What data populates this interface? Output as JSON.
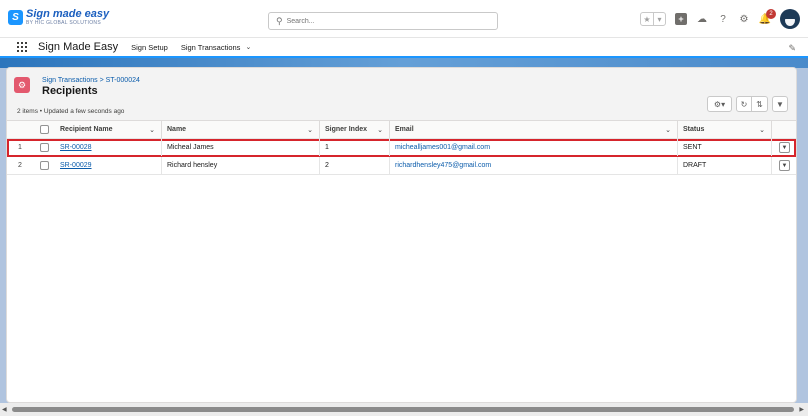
{
  "brand": {
    "logo_main": "Sign made easy",
    "logo_sub": "BY HIC GLOBAL SOLUTIONS",
    "logo_mark": "S"
  },
  "search": {
    "placeholder": "Search..."
  },
  "header": {
    "notification_count": "2",
    "icons": [
      "star-icon",
      "chevron-down-icon",
      "plus-icon",
      "cloud-icon",
      "help-icon",
      "gear-icon",
      "bell-icon",
      "avatar"
    ]
  },
  "nav": {
    "app_name": "Sign Made Easy",
    "items": [
      {
        "label": "Sign Setup"
      },
      {
        "label": "Sign Transactions"
      }
    ]
  },
  "list": {
    "breadcrumb": "Sign Transactions > ST-000024",
    "title": "Recipients",
    "meta": "2 items • Updated a few seconds ago"
  },
  "table": {
    "columns": [
      "Recipient Name",
      "Name",
      "Signer Index",
      "Email",
      "Status"
    ],
    "rows": [
      {
        "num": "1",
        "recipient": "SR-00028",
        "name": "Micheal James",
        "index": "1",
        "email": "michealljames001@gmail.com",
        "status": "SENT"
      },
      {
        "num": "2",
        "recipient": "SR-00029",
        "name": "Richard hensley",
        "index": "2",
        "email": "richardhensley475@gmail.com",
        "status": "DRAFT"
      }
    ]
  },
  "colors": {
    "accent": "#1b96ff",
    "link": "#0b5cab",
    "highlight": "#d6252c",
    "object_icon": "#e3596e"
  }
}
